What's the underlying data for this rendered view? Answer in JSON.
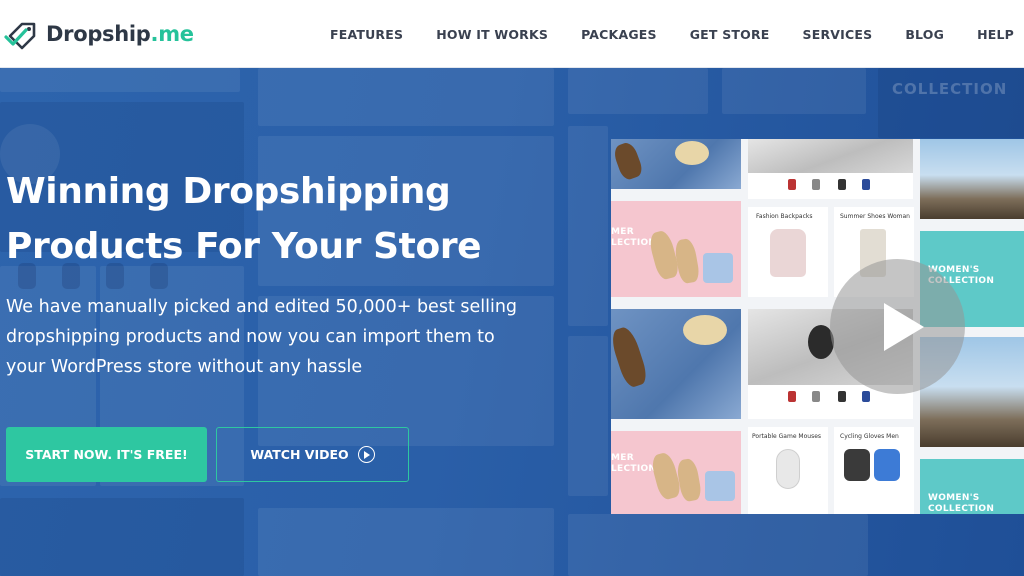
{
  "brand": {
    "name_main": "Dropship",
    "name_tld": ".me",
    "accent_color": "#2ec7a1"
  },
  "nav": {
    "items": [
      "FEATURES",
      "HOW IT WORKS",
      "PACKAGES",
      "GET STORE",
      "SERVICES",
      "BLOG",
      "HELP"
    ]
  },
  "hero": {
    "headline_line1": "Winning Dropshipping",
    "headline_line2": "Products For Your Store",
    "subtext_line1": "We have manually picked and edited 50,000+ best selling",
    "subtext_line2": "dropshipping products and now you can import them to",
    "subtext_line3": "your WordPress store without any hassle",
    "cta_primary": "START NOW. IT'S FREE!",
    "cta_secondary": "WATCH VIDEO"
  },
  "video_preview": {
    "collection_label_left_1": "MER\nLECTION",
    "collection_label_left_2": "MER\nLECTION",
    "collection_label_right_1": "WOMEN'S\nCOLLECTION",
    "collection_label_right_2": "WOMEN'S\nCOLLECTION",
    "product_1": "Fashion Backpacks",
    "product_2": "Summer Shoes Woman",
    "product_3": "Portable Game Mouses",
    "product_4": "Cycling Gloves Men"
  },
  "background": {
    "ghost_text": "COLLECTION"
  }
}
